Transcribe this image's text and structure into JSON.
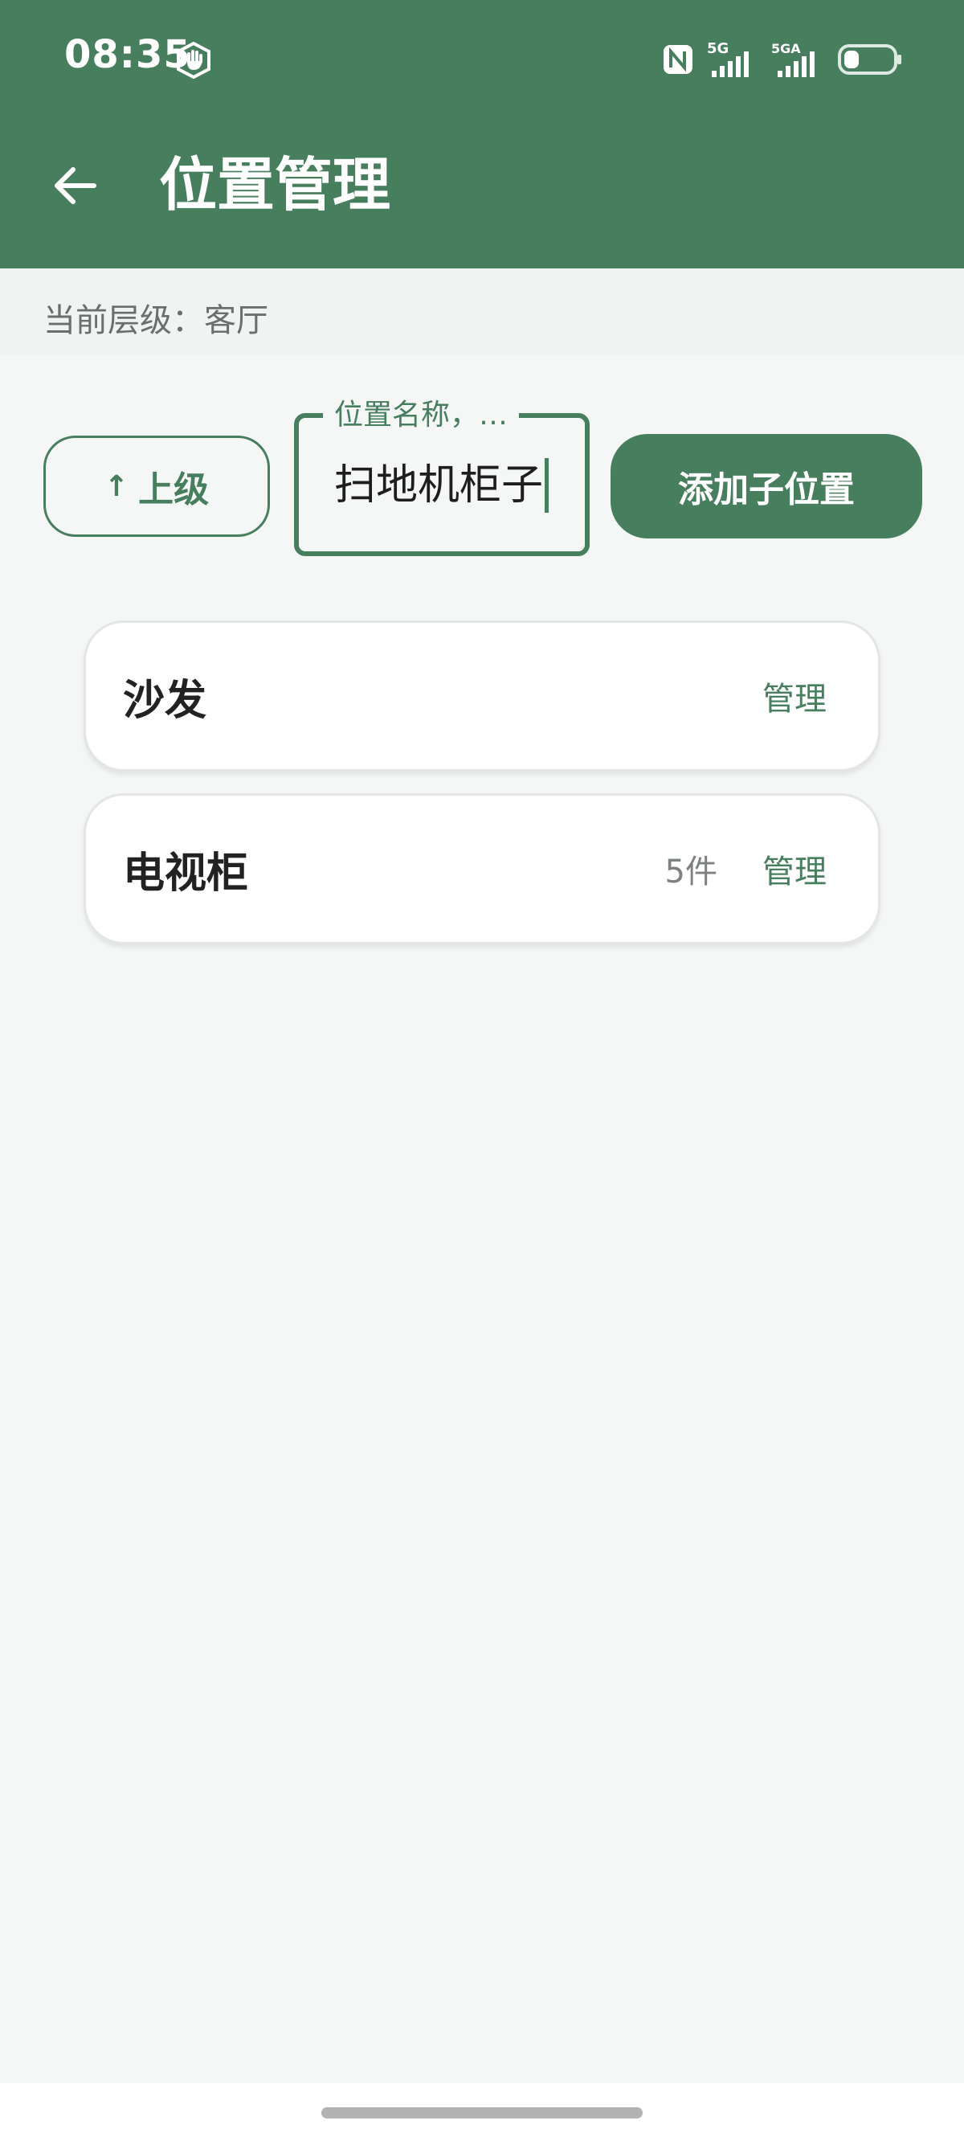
{
  "status_bar": {
    "time": "08:35",
    "network_1_label": "5G",
    "network_2_label": "5GA",
    "icons": [
      "hand-icon",
      "nfc-icon",
      "signal-icon",
      "signal-icon",
      "battery-icon"
    ]
  },
  "header": {
    "title": "位置管理",
    "back_icon": "arrow-left-icon"
  },
  "level": {
    "text": "当前层级：客厅"
  },
  "controls": {
    "up_arrow": "↑",
    "up_label": "上级",
    "name_field_label": "位置名称，…",
    "name_field_value": "扫地机柜子",
    "add_label": "添加子位置"
  },
  "locations": [
    {
      "name": "沙发",
      "count": "",
      "manage_label": "管理"
    },
    {
      "name": "电视柜",
      "count": "5件",
      "manage_label": "管理"
    }
  ],
  "colors": {
    "primary": "#477e5e",
    "background": "#f5f7f6",
    "card": "#ffffff"
  }
}
